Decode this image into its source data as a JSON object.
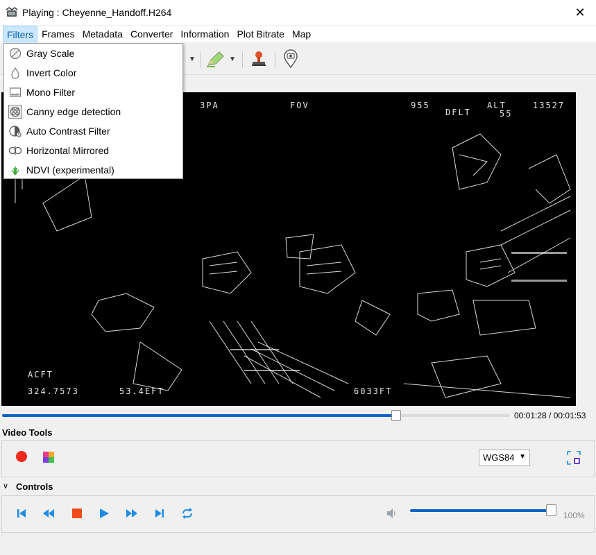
{
  "window": {
    "title": "Playing : Cheyenne_Handoff.H264",
    "close_glyph": "✕"
  },
  "menubar": {
    "items": [
      "Filters",
      "Frames",
      "Metadata",
      "Converter",
      "Information",
      "Plot Bitrate",
      "Map"
    ],
    "active": "Filters"
  },
  "filters_menu": {
    "items": [
      {
        "label": "Gray Scale",
        "icon": "gray-scale-icon"
      },
      {
        "label": "Invert Color",
        "icon": "invert-color-icon"
      },
      {
        "label": "Mono Filter",
        "icon": "mono-filter-icon"
      },
      {
        "label": "Canny edge detection",
        "icon": "canny-edge-icon",
        "checked": true
      },
      {
        "label": "Auto Contrast Filter",
        "icon": "auto-contrast-icon"
      },
      {
        "label": "Horizontal Mirrored",
        "icon": "mirror-icon"
      },
      {
        "label": "NDVI (experimental)",
        "icon": "ndvi-grass-icon"
      }
    ]
  },
  "video_osd": {
    "top_left": "3PA",
    "top_center": "FOV",
    "top_mid": "955",
    "top_right_label": "ALT",
    "top_right_value": "13527",
    "deflt": "DFLT",
    "deflt_value": "55",
    "bottom_left_1": "ACFT",
    "bottom_left_2": "324.7573",
    "bottom_left_3": "53.4EFT",
    "bottom_right": "6033FT"
  },
  "seek": {
    "current": "00:01:28",
    "total": "00:01:53",
    "time_text": "00:01:28 / 00:01:53",
    "progress": 0.776
  },
  "video_tools": {
    "title": "Video Tools",
    "crs_value": "WGS84"
  },
  "controls": {
    "title": "Controls",
    "volume_text": "100%",
    "volume": 1.0
  },
  "colors": {
    "accent": "#0a64c8",
    "record": "#f02a1a",
    "control_icon": "#1e8ce6",
    "stop": "#f04a1a"
  }
}
